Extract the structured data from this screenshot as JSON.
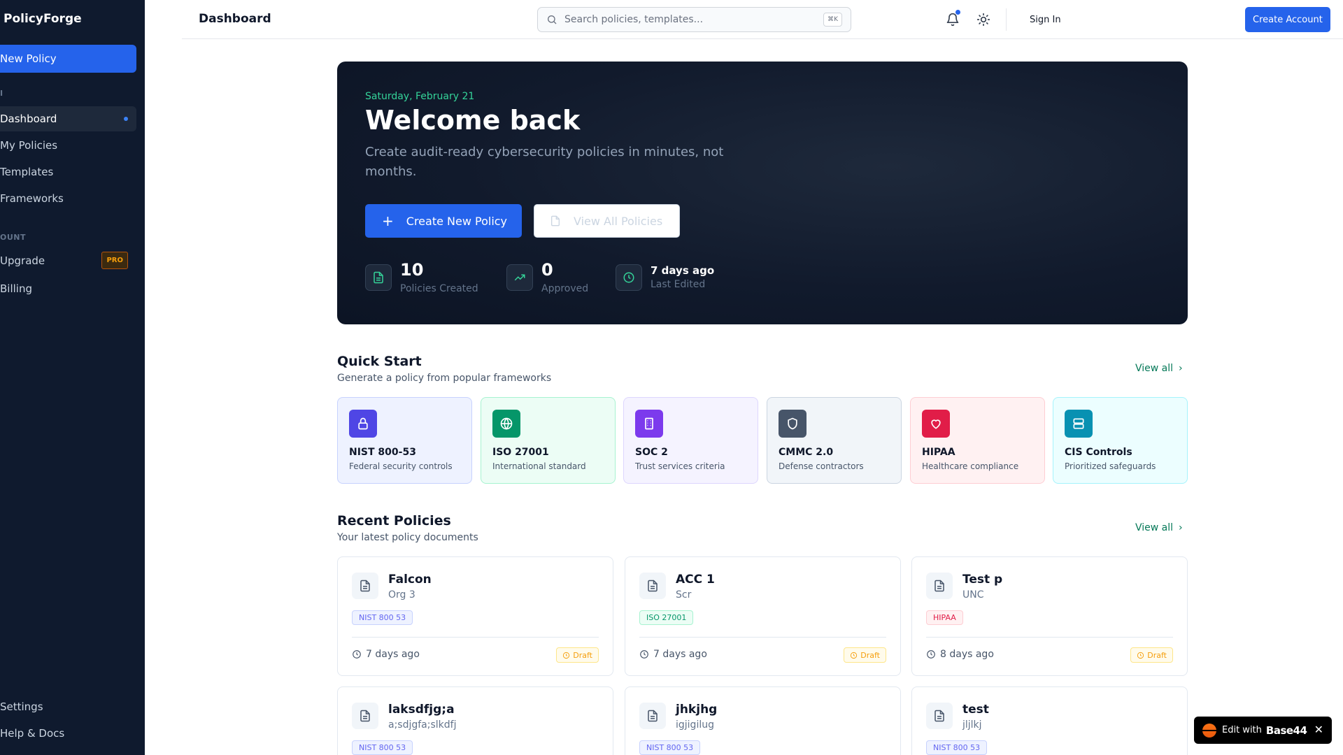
{
  "sidebar": {
    "brand": "PolicyForge",
    "new_policy": "New Policy",
    "main_label": "I",
    "items": [
      {
        "label": "Dashboard"
      },
      {
        "label": "My Policies"
      },
      {
        "label": "Templates"
      },
      {
        "label": "Frameworks"
      }
    ],
    "account_label": "OUNT",
    "account_items": [
      {
        "label": "Upgrade",
        "badge": "PRO"
      },
      {
        "label": "Billing"
      }
    ],
    "bottom_items": [
      {
        "label": "Settings"
      },
      {
        "label": "Help & Docs"
      }
    ]
  },
  "header": {
    "title": "Dashboard",
    "search_placeholder": "Search policies, templates...",
    "search_shortcut": "⌘K",
    "sign_in": "Sign In",
    "create_account": "Create Account"
  },
  "hero": {
    "date": "Saturday, February 21",
    "title": "Welcome back",
    "subtitle": "Create audit-ready cybersecurity policies in minutes, not months.",
    "create_button": "Create New Policy",
    "view_button": "View All Policies",
    "stats": [
      {
        "value": "10",
        "label": "Policies Created"
      },
      {
        "value": "0",
        "label": "Approved"
      },
      {
        "value": "7 days ago",
        "label": "Last Edited"
      }
    ]
  },
  "quick_start": {
    "title": "Quick Start",
    "subtitle": "Generate a policy from popular frameworks",
    "view_all": "View all",
    "frameworks": [
      {
        "name": "NIST 800-53",
        "desc": "Federal security controls",
        "icon": "lock-icon",
        "color": "#4f46e5",
        "bg": "#eef2ff",
        "border": "#c7d2fe"
      },
      {
        "name": "ISO 27001",
        "desc": "International standard",
        "icon": "globe-icon",
        "color": "#059669",
        "bg": "#ecfdf5",
        "border": "#a7f3d0"
      },
      {
        "name": "SOC 2",
        "desc": "Trust services criteria",
        "icon": "building-icon",
        "color": "#7c3aed",
        "bg": "#f5f3ff",
        "border": "#ddd6fe"
      },
      {
        "name": "CMMC 2.0",
        "desc": "Defense contractors",
        "icon": "shield-icon",
        "color": "#475569",
        "bg": "#f1f5f9",
        "border": "#cbd5e1"
      },
      {
        "name": "HIPAA",
        "desc": "Healthcare compliance",
        "icon": "heart-icon",
        "color": "#e11d48",
        "bg": "#fff1f2",
        "border": "#fecdd3"
      },
      {
        "name": "CIS Controls",
        "desc": "Prioritized safeguards",
        "icon": "server-icon",
        "color": "#0891b2",
        "bg": "#ecfeff",
        "border": "#a5f3fc"
      }
    ]
  },
  "recent": {
    "title": "Recent Policies",
    "subtitle": "Your latest policy documents",
    "view_all": "View all",
    "policies": [
      {
        "title": "Falcon",
        "org": "Org 3",
        "tag": "NIST 800 53",
        "time": "7 days ago",
        "status": "Draft"
      },
      {
        "title": "ACC 1",
        "org": "Scr",
        "tag": "ISO 27001",
        "time": "7 days ago",
        "status": "Draft"
      },
      {
        "title": "Test p",
        "org": "UNC",
        "tag": "HIPAA",
        "time": "8 days ago",
        "status": "Draft"
      },
      {
        "title": "laksdfjg;a",
        "org": "a;sdjgfa;slkdfj",
        "tag": "NIST 800 53"
      },
      {
        "title": "jhkjhg",
        "org": "igjigilug",
        "tag": "NIST 800 53"
      },
      {
        "title": "test",
        "org": "jljlkj",
        "tag": "NIST 800 53"
      }
    ]
  },
  "badge": {
    "edit_with": "Edit with",
    "brand": "Base44",
    "close": "✕"
  }
}
